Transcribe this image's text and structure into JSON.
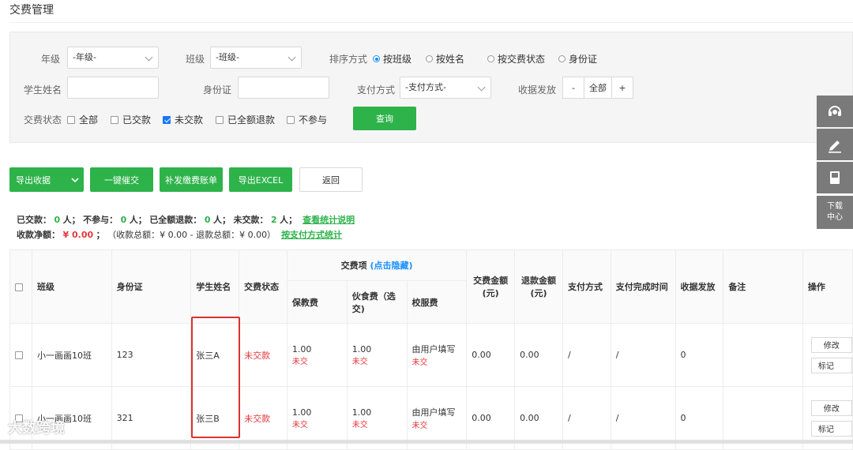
{
  "page": {
    "title": "交费管理"
  },
  "filters": {
    "grade_label": "年级",
    "grade_value": "-年级-",
    "class_label": "班级",
    "class_value": "-班级-",
    "sort_label": "排序方式",
    "sort_options": [
      "按班级",
      "按姓名",
      "按交费状态",
      "身份证"
    ],
    "sort_selected": "按班级",
    "student_name_label": "学生姓名",
    "student_name_value": "",
    "id_label": "身份证",
    "id_value": "",
    "payment_method_label": "支付方式",
    "payment_method_value": "-支付方式-",
    "receipt_label": "收据发放",
    "receipt_minus": "-",
    "receipt_value": "全部",
    "receipt_plus": "+",
    "status_label": "交费状态",
    "status_options": [
      {
        "label": "全部",
        "checked": false
      },
      {
        "label": "已交款",
        "checked": false
      },
      {
        "label": "未交款",
        "checked": true
      },
      {
        "label": "已全额退款",
        "checked": false
      },
      {
        "label": "不参与",
        "checked": false
      }
    ],
    "query_button": "查询"
  },
  "toolbar": {
    "export_data": "导出收据",
    "one_click_remind": "一键催交",
    "reissue_bill": "补发缴费账单",
    "export_excel": "导出EXCEL",
    "back": "返回"
  },
  "summary": {
    "paid_label": "已交款：",
    "paid_count": "0",
    "paid_unit": "人；",
    "not_participate_label": "不参与：",
    "not_participate_count": "0",
    "not_participate_unit": "人；",
    "full_refund_label": "已全额退款：",
    "full_refund_count": "0",
    "full_refund_unit": "人；",
    "unpaid_label": "未交款：",
    "unpaid_count": "2",
    "unpaid_unit": "人；",
    "stats_link": "查看统计说明",
    "net_label": "收款净额：",
    "net_value": "¥ 0.00",
    "net_suffix": "；",
    "totals_text": "（收款总额：¥ 0.00  -  退款总额：¥ 0.00）",
    "payment_stats_link": "按支付方式统计"
  },
  "table": {
    "headers": {
      "class": "班级",
      "id": "身份证",
      "name": "学生姓名",
      "status": "交费状态",
      "fee_items": "交费项",
      "fee_items_toggle": "(点击隐藏)",
      "fee_insurance": "保教费",
      "fee_meal": "伙食费（选交)",
      "fee_uniform": "校服费",
      "paid_amount": "交费金额(元)",
      "refund_amount": "退款金额(元)",
      "pay_method": "支付方式",
      "pay_time": "支付完成时间",
      "receipt": "收据发放",
      "remark": "备注",
      "actions": "操作"
    },
    "rows": [
      {
        "class": "小一画画10班",
        "id": "123",
        "name": "张三A",
        "status": "未交款",
        "insurance": "1.00",
        "insurance_status": "未交",
        "meal": "1.00",
        "meal_status": "未交",
        "uniform": "由用户填写",
        "uniform_status": "未交",
        "paid_amount": "0.00",
        "refund_amount": "0.00",
        "pay_method": "/",
        "pay_time": "/",
        "receipt": "0",
        "remark": "",
        "edit": "修改",
        "mark": "标记"
      },
      {
        "class": "小一画画10班",
        "id": "321",
        "name": "张三B",
        "status": "未交款",
        "insurance": "1.00",
        "insurance_status": "未交",
        "meal": "1.00",
        "meal_status": "未交",
        "uniform": "由用户填写",
        "uniform_status": "未交",
        "paid_amount": "0.00",
        "refund_amount": "0.00",
        "pay_method": "/",
        "pay_time": "/",
        "receipt": "0",
        "remark": "",
        "edit": "修改",
        "mark": "标记"
      }
    ]
  },
  "side_tools": {
    "icons": [
      "headset-icon",
      "edit-icon",
      "book-icon"
    ],
    "download_line1": "下载",
    "download_line2": "中心"
  },
  "watermark": "大数跨境",
  "colors": {
    "primary_green": "#2db34a",
    "danger_red": "#e4393c",
    "highlight_red": "#d9322f",
    "checkbox_blue": "#1677ff",
    "side_tool_gray": "#7a7a7a"
  }
}
